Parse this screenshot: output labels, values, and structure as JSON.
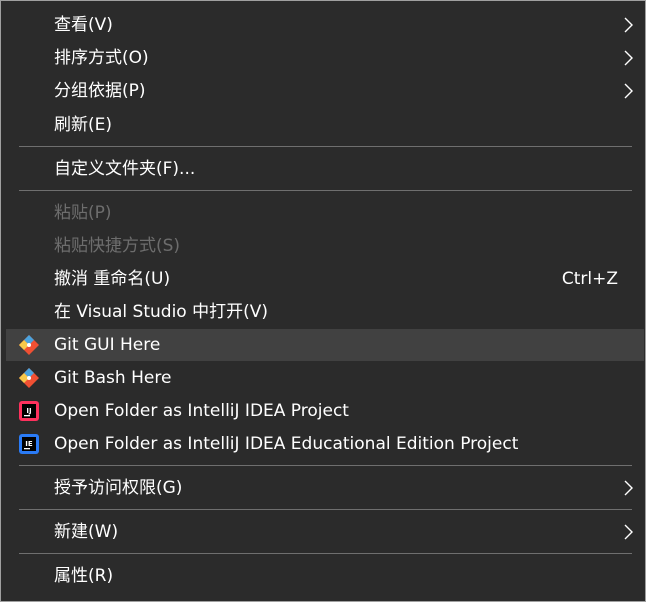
{
  "menu": {
    "items": [
      {
        "label": "查看(V)",
        "submenu": true
      },
      {
        "label": "排序方式(O)",
        "submenu": true
      },
      {
        "label": "分组依据(P)",
        "submenu": true
      },
      {
        "label": "刷新(E)"
      },
      {
        "label": "自定义文件夹(F)..."
      },
      {
        "label": "粘贴(P)",
        "disabled": true
      },
      {
        "label": "粘贴快捷方式(S)",
        "disabled": true
      },
      {
        "label": "撤消 重命名(U)",
        "shortcut": "Ctrl+Z"
      },
      {
        "label": "在 Visual Studio 中打开(V)"
      },
      {
        "label": "Git GUI Here",
        "icon": "git-icon",
        "hovered": true
      },
      {
        "label": "Git Bash Here",
        "icon": "git-icon"
      },
      {
        "label": "Open Folder as IntelliJ IDEA Project",
        "icon": "intellij-idea-icon",
        "icon_text": "IJ"
      },
      {
        "label": "Open Folder as IntelliJ IDEA Educational Edition Project",
        "icon": "intellij-idea-edu-icon",
        "icon_text": "IE"
      },
      {
        "label": "授予访问权限(G)",
        "submenu": true
      },
      {
        "label": "新建(W)",
        "submenu": true
      },
      {
        "label": "属性(R)"
      }
    ]
  },
  "icons": {
    "submenu_arrow": "chevron-right-icon"
  },
  "colors": {
    "background": "#2b2b2b",
    "text": "#ffffff",
    "disabled_text": "#6d6d6d",
    "hover_background": "#414141",
    "separator": "#6f6f6f",
    "git_orange": "#f05033",
    "git_blue": "#4aa3df",
    "git_yellow": "#f7c94b"
  }
}
